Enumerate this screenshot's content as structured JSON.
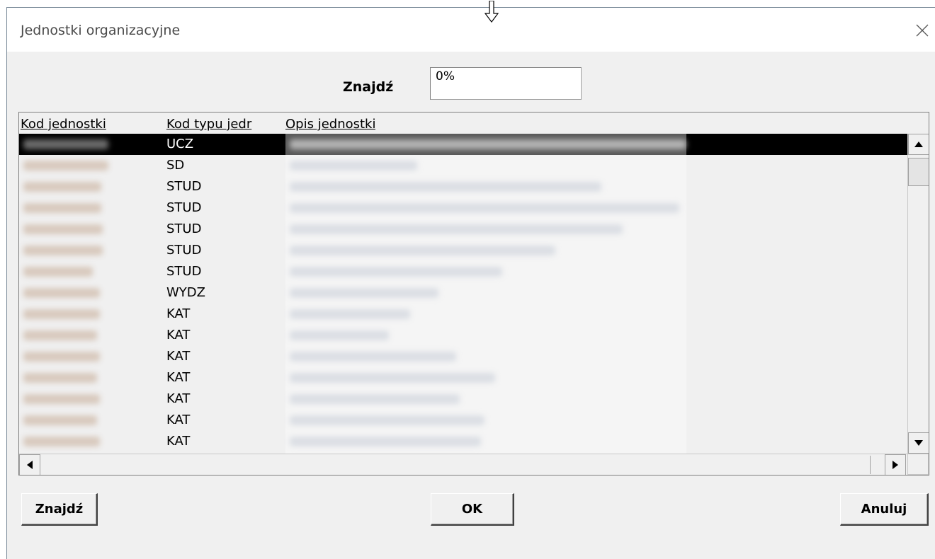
{
  "window": {
    "title": "Jednostki organizacyjne"
  },
  "search": {
    "label": "Znajdź",
    "value": "0%"
  },
  "grid": {
    "columns": [
      "Kod jednostki",
      "Kod typu jedr",
      "Opis jednostki"
    ],
    "rows": [
      {
        "type": "UCZ",
        "selected": true
      },
      {
        "type": "SD"
      },
      {
        "type": "STUD"
      },
      {
        "type": "STUD"
      },
      {
        "type": "STUD"
      },
      {
        "type": "STUD"
      },
      {
        "type": "STUD"
      },
      {
        "type": "WYDZ"
      },
      {
        "type": "KAT"
      },
      {
        "type": "KAT"
      },
      {
        "type": "KAT"
      },
      {
        "type": "KAT"
      },
      {
        "type": "KAT"
      },
      {
        "type": "KAT"
      },
      {
        "type": "KAT"
      }
    ]
  },
  "buttons": {
    "find": "Znajdź",
    "ok": "OK",
    "cancel": "Anuluj"
  }
}
